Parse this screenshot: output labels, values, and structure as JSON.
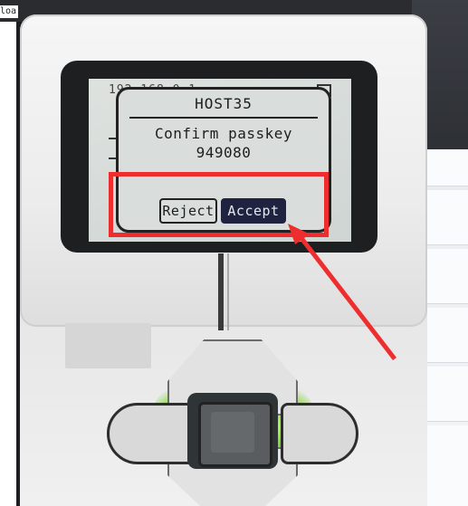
{
  "corner_label": "loa",
  "screen": {
    "background_text": "192.168.0.1",
    "dialog": {
      "title": "HOST35",
      "message_line1": "Confirm passkey",
      "passkey": "949080",
      "reject_label": "Reject",
      "accept_label": "Accept"
    }
  },
  "annotation": {
    "color": "#ee2e2e",
    "target": "accept-button"
  },
  "colors": {
    "lcd": "#d9dedc",
    "selected_button": "#1f2340",
    "led_glow": "#7fd332"
  }
}
